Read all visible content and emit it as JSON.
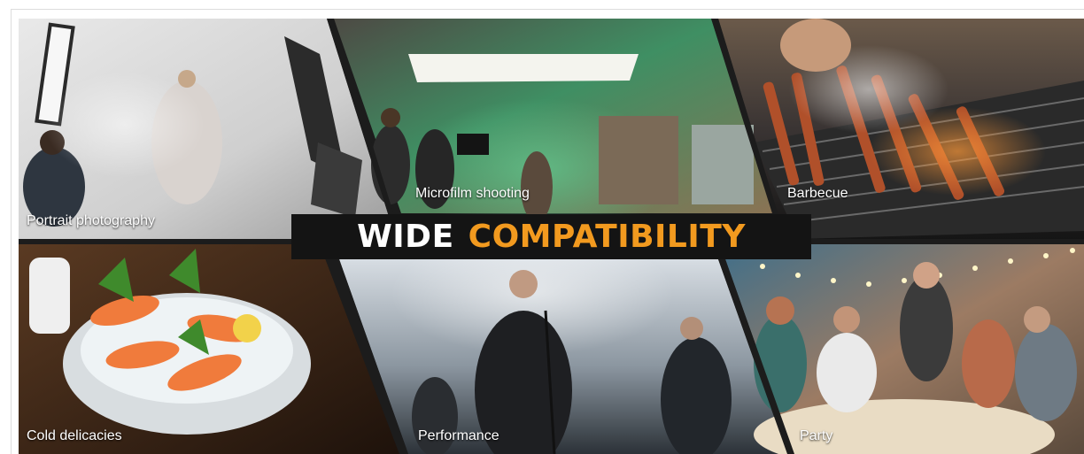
{
  "headline": {
    "word1": "WIDE",
    "word2": "COMPATIBILITY"
  },
  "colors": {
    "accent": "#f29a1f",
    "headline_bg": "#141414",
    "divider": "#1c1c1c"
  },
  "scenes": {
    "portrait": {
      "label": "Portrait photography"
    },
    "microfilm": {
      "label": "Microfilm shooting"
    },
    "barbecue": {
      "label": "Barbecue"
    },
    "cold": {
      "label": "Cold delicacies"
    },
    "performance": {
      "label": "Performance"
    },
    "party": {
      "label": "Party"
    }
  }
}
